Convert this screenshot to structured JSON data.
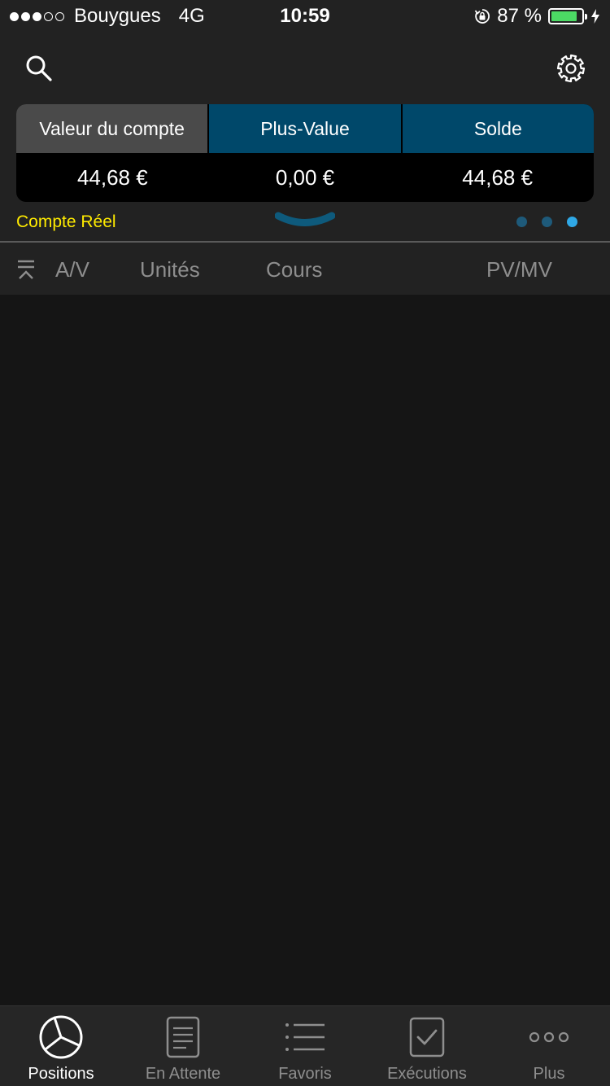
{
  "status_bar": {
    "carrier": "Bouygues",
    "network": "4G",
    "time": "10:59",
    "battery": "87 %",
    "battery_level": 0.87,
    "signal_bars": 3,
    "signal_total": 5
  },
  "summary": {
    "headers": [
      "Valeur du compte",
      "Plus-Value",
      "Solde"
    ],
    "values": [
      "44,68 €",
      "0,00 €",
      "44,68 €"
    ],
    "active_index": 0
  },
  "account": {
    "label": "Compte Réel",
    "page_count": 3,
    "active_page": 2
  },
  "columns": {
    "buy_sell": "A/V",
    "units": "Unités",
    "price": "Cours",
    "pnl": "PV/MV"
  },
  "tabs": [
    {
      "label": "Positions",
      "icon": "pie-chart-icon",
      "active": true
    },
    {
      "label": "En Attente",
      "icon": "document-icon",
      "active": false
    },
    {
      "label": "Favoris",
      "icon": "list-icon",
      "active": false
    },
    {
      "label": "Exécutions",
      "icon": "checkbox-icon",
      "active": false
    },
    {
      "label": "Plus",
      "icon": "more-icon",
      "active": false
    }
  ],
  "colors": {
    "accent_blue": "#00486a",
    "account_yellow": "#ffeb00",
    "dot_active": "#2fa8e6",
    "battery_green": "#4cd964"
  }
}
